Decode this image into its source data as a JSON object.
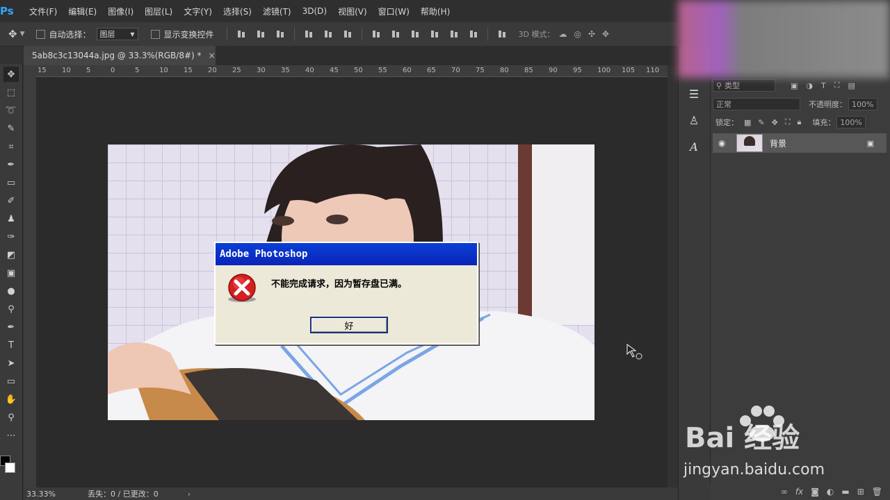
{
  "app": {
    "logo": "Ps"
  },
  "menu": [
    "文件(F)",
    "编辑(E)",
    "图像(I)",
    "图层(L)",
    "文字(Y)",
    "选择(S)",
    "滤镜(T)",
    "3D(D)",
    "视图(V)",
    "窗口(W)",
    "帮助(H)"
  ],
  "options": {
    "auto_select_label": "自动选择：",
    "auto_select_value": "图层",
    "show_transform_label": "显示变换控件",
    "mode_3d_label": "3D 模式："
  },
  "document": {
    "tab_title": "5ab8c3c13044a.jpg @ 33.3%(RGB/8#) *",
    "close": "×"
  },
  "ruler": {
    "h_ticks": [
      "15",
      "10",
      "5",
      "0",
      "5",
      "10",
      "15",
      "20",
      "25",
      "30",
      "35",
      "40",
      "45",
      "50",
      "55",
      "60",
      "65",
      "70",
      "75",
      "80",
      "85",
      "90",
      "95",
      "100",
      "105",
      "110"
    ]
  },
  "status": {
    "zoom": "33.33%",
    "info": "丢失：0 / 已更改：0"
  },
  "dialog": {
    "title": "Adobe Photoshop",
    "message": "不能完成请求，因为暂存盘已满。",
    "ok_label": "好",
    "icon": "error-icon"
  },
  "layers_panel": {
    "search_placeholder": "类型",
    "blend_mode": "正常",
    "opacity_label": "不透明度：",
    "opacity_value": "100%",
    "lock_label": "锁定：",
    "fill_label": "填充：",
    "fill_value": "100%",
    "layers": [
      {
        "name": "背景",
        "visible": true,
        "locked": true
      }
    ]
  },
  "watermark": {
    "logo": "Bai 经验",
    "url": "jingyan.baidu.com"
  }
}
